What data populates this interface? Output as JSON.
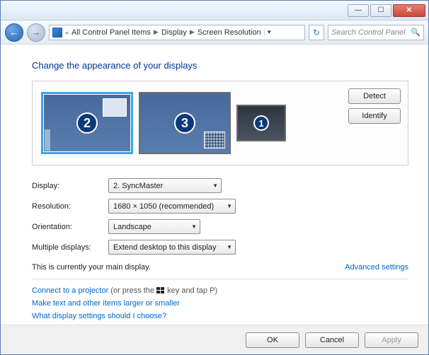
{
  "titlebar": {
    "min": "—",
    "max": "☐",
    "close": "✕"
  },
  "toolbar": {
    "back_glyph": "←",
    "fwd_glyph": "→",
    "breadcrumb_prefix": "«",
    "crumb1": "All Control Panel Items",
    "crumb2": "Display",
    "crumb3": "Screen Resolution",
    "refresh_glyph": "↻",
    "search_placeholder": "Search Control Panel",
    "search_icon": "🔍"
  },
  "heading": "Change the appearance of your displays",
  "monitors": {
    "m2": "2",
    "m3": "3",
    "m1": "1",
    "detect": "Detect",
    "identify": "Identify"
  },
  "form": {
    "display_label": "Display:",
    "display_value": "2. SyncMaster",
    "resolution_label": "Resolution:",
    "resolution_value": "1680 × 1050 (recommended)",
    "orientation_label": "Orientation:",
    "orientation_value": "Landscape",
    "multiple_label": "Multiple displays:",
    "multiple_value": "Extend desktop to this display"
  },
  "status_text": "This is currently your main display.",
  "advanced_link": "Advanced settings",
  "projector_link": "Connect to a projector",
  "projector_hint_before": " (or press the ",
  "projector_hint_after": " key and tap P)",
  "textsize_link": "Make text and other items larger or smaller",
  "whatsettings_link": "What display settings should I choose?",
  "footer": {
    "ok": "OK",
    "cancel": "Cancel",
    "apply": "Apply"
  }
}
